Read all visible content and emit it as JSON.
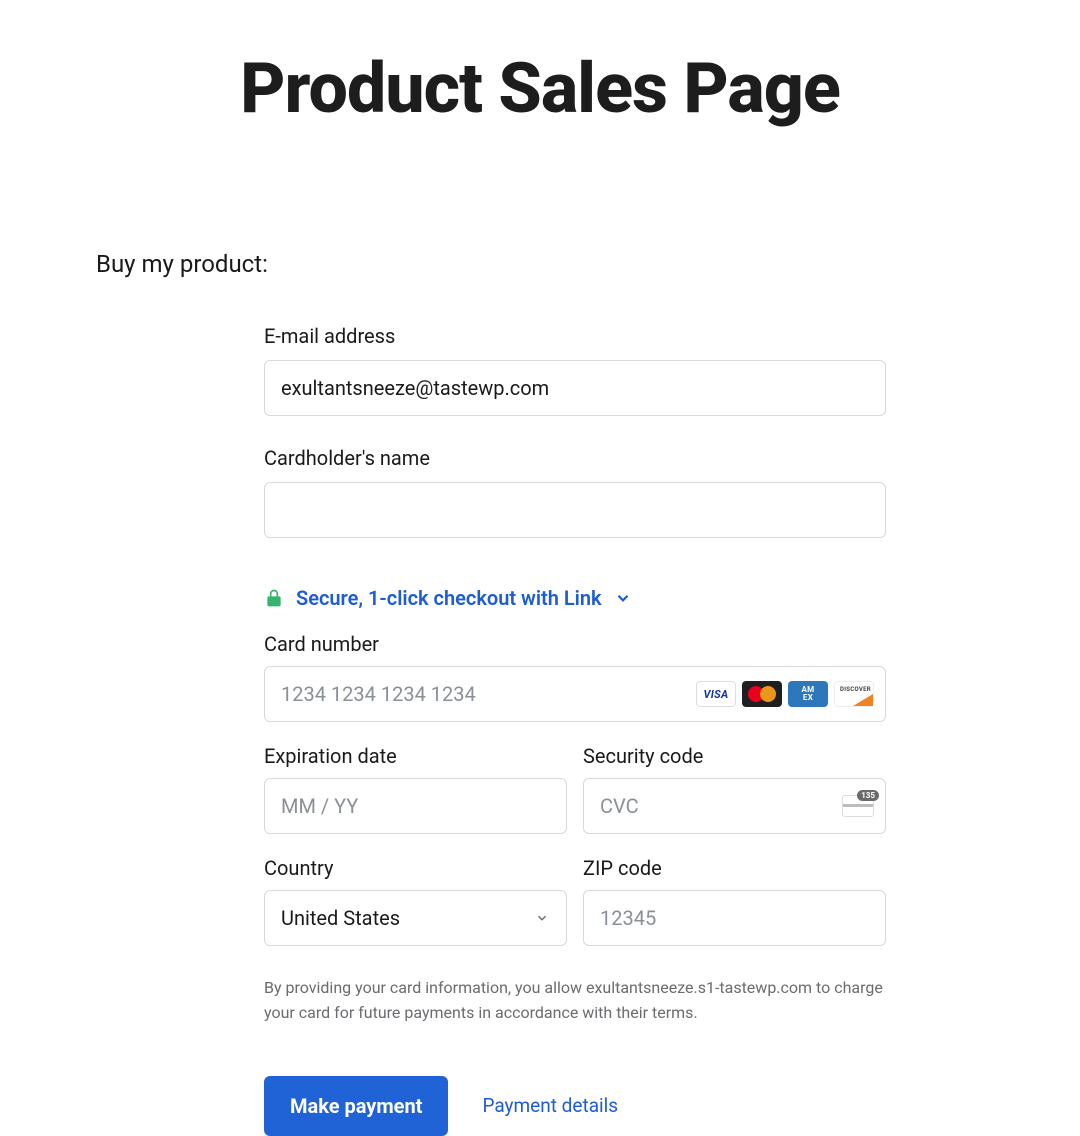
{
  "page": {
    "title": "Product Sales Page",
    "lead": "Buy my product:"
  },
  "form": {
    "email_label": "E-mail address",
    "email_value": "exultantsneeze@tastewp.com",
    "cardholder_label": "Cardholder's name",
    "cardholder_value": ""
  },
  "link": {
    "secure_text": "Secure, 1-click checkout with Link"
  },
  "card": {
    "number_label": "Card number",
    "number_placeholder": "1234 1234 1234 1234",
    "exp_label": "Expiration date",
    "exp_placeholder": "MM / YY",
    "cvc_label": "Security code",
    "cvc_placeholder": "CVC",
    "cvc_badge": "135",
    "country_label": "Country",
    "country_value": "United States",
    "zip_label": "ZIP code",
    "zip_placeholder": "12345",
    "brands": {
      "visa": "VISA",
      "amex_line1": "AM",
      "amex_line2": "EX",
      "discover": "DISCOVER"
    }
  },
  "disclaimer": "By providing your card information, you allow exultantsneeze.s1-tastewp.com to charge your card for future payments in accordance with their terms.",
  "actions": {
    "submit_label": "Make payment",
    "details_label": "Payment details"
  }
}
